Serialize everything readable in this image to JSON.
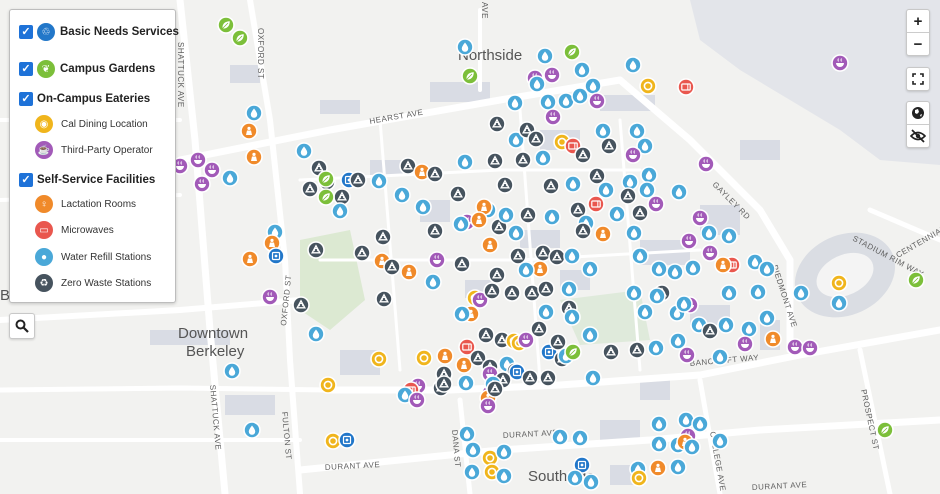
{
  "colors": {
    "basic_needs": "#2277c9",
    "garden": "#7cbf3a",
    "cal_dining": "#f0b51c",
    "third_party": "#a25ab8",
    "lactation": "#f08a2a",
    "microwave": "#e9574e",
    "water": "#4aa8d8",
    "zero_waste": "#46535e",
    "road": "#ffffff",
    "park": "#dce9d2",
    "building": "#d9dce4",
    "water_body": "#e3e5ea",
    "stadium": "#dadde3"
  },
  "legend": {
    "basic_needs_label": "Basic Needs Services",
    "campus_gardens_label": "Campus Gardens",
    "eateries_label": "On-Campus Eateries",
    "cal_dining_label": "Cal Dining Location",
    "third_party_label": "Third-Party Operator",
    "self_service_label": "Self-Service Facilities",
    "lactation_label": "Lactation Rooms",
    "microwaves_label": "Microwaves",
    "water_refill_label": "Water Refill Stations",
    "zero_waste_label": "Zero Waste Stations"
  },
  "controls": {
    "zoom_in": "+",
    "zoom_out": "−",
    "fullscreen_icon": "fullscreen-icon",
    "globe_icon": "globe-icon",
    "hide_icon": "eye-slash-icon",
    "search_icon": "search-icon"
  },
  "map_labels": {
    "northside": "Northside",
    "downtown": "Downtown",
    "berkeley": "Berkeley",
    "southside": "Southside",
    "partial_left": "B",
    "shattuck": "SHATTUCK AVE",
    "oxford": "OXFORD ST",
    "fulton": "FULTON ST",
    "hearst": "HEARST AVE",
    "gayley": "GAYLEY RD",
    "piedmont": "PIEDMONT AVE",
    "stadium_rim": "STADIUM RIM WAY",
    "centennial": "CENTENNIAL",
    "bancroft": "BANCROFT WAY",
    "durant": "DURANT AVE",
    "dana": "DANA ST",
    "college": "COLLEGE AVE",
    "prospect": "PROSPECT ST",
    "euclid_partial": "AVE"
  }
}
